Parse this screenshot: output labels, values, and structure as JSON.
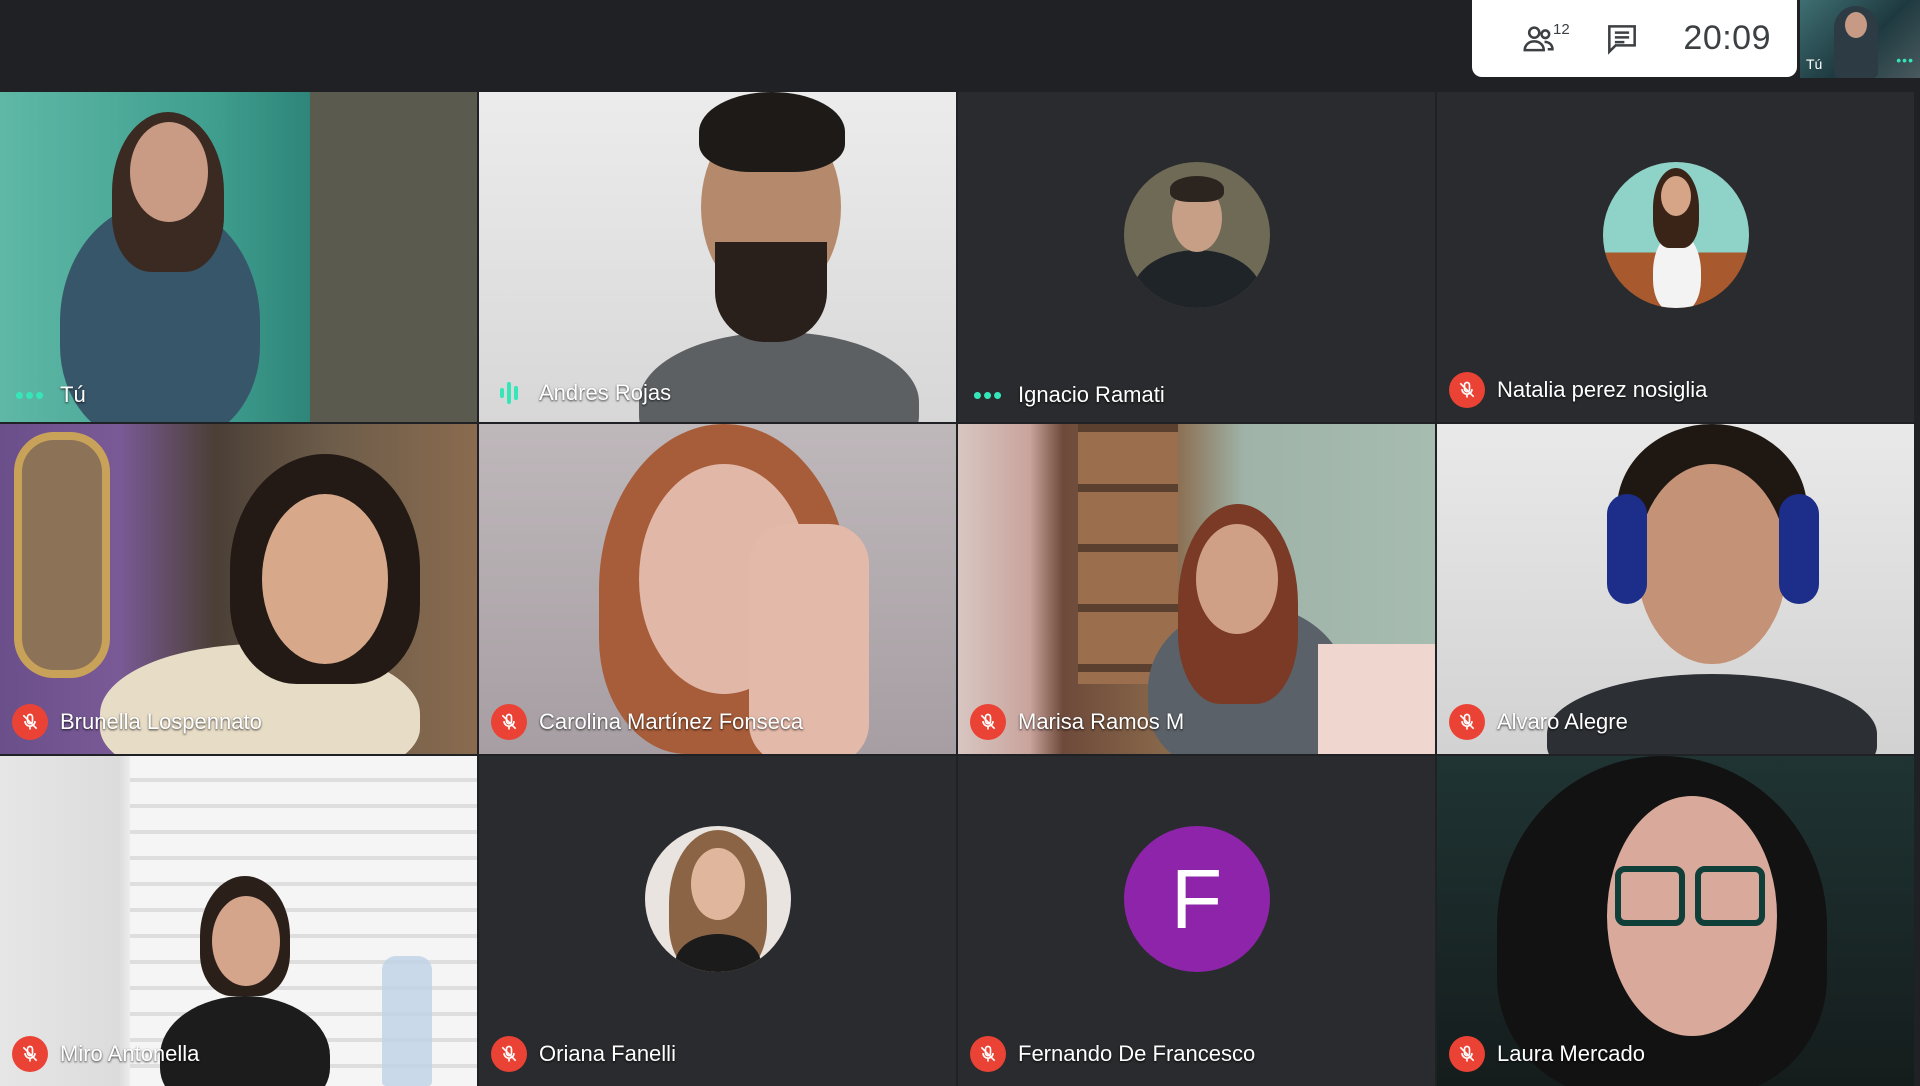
{
  "top_panel": {
    "participants_count": "12",
    "time": "20:09",
    "self_label": "Tú"
  },
  "participants": [
    {
      "name": "Tú",
      "status": "speaking-dots",
      "type": "video"
    },
    {
      "name": "Andres Rojas",
      "status": "speaking-wave",
      "type": "video"
    },
    {
      "name": "Ignacio Ramati",
      "status": "speaking-dots",
      "type": "photo-avatar"
    },
    {
      "name": "Natalia perez nosiglia",
      "status": "muted",
      "type": "photo-avatar"
    },
    {
      "name": "Brunella Lospennato",
      "status": "muted",
      "type": "video"
    },
    {
      "name": "Carolina Martínez Fonseca",
      "status": "muted",
      "type": "video"
    },
    {
      "name": "Marisa Ramos M",
      "status": "muted",
      "type": "video"
    },
    {
      "name": "Alvaro Alegre",
      "status": "muted",
      "type": "video"
    },
    {
      "name": "Miro Antonella",
      "status": "muted",
      "type": "video"
    },
    {
      "name": "Oriana Fanelli",
      "status": "muted",
      "type": "photo-avatar"
    },
    {
      "name": "Fernando De Francesco",
      "status": "muted",
      "type": "letter-avatar",
      "avatar_letter": "F",
      "avatar_color": "#8e24aa"
    },
    {
      "name": "Laura Mercado",
      "status": "muted",
      "type": "video"
    }
  ],
  "colors": {
    "background": "#202124",
    "speaking_accent": "#34e6b8",
    "muted_badge": "#ea4335"
  }
}
